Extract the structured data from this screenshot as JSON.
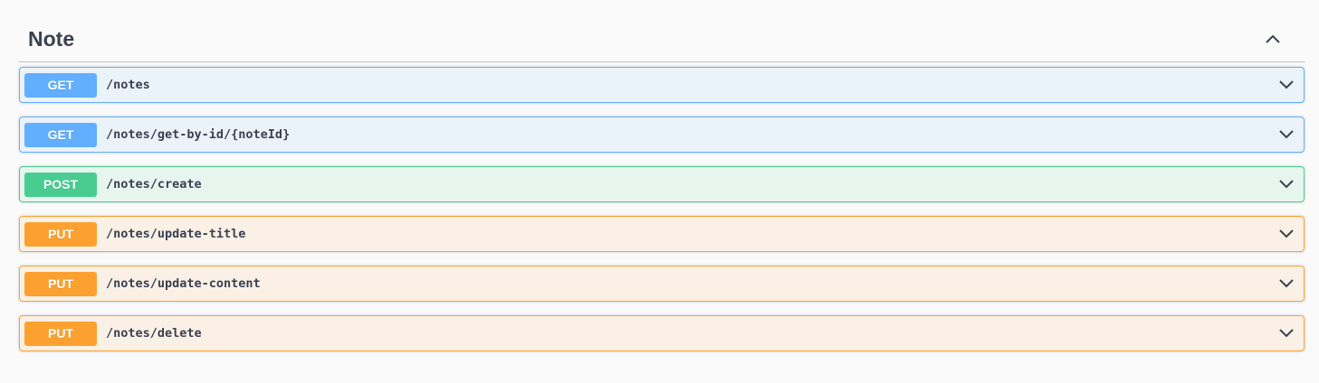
{
  "tag": {
    "title": "Note",
    "toggle_icon": "chevron-up-icon"
  },
  "operations": [
    {
      "method": "GET",
      "path": "/notes",
      "kind": "get"
    },
    {
      "method": "GET",
      "path": "/notes/get-by-id/{noteId}",
      "kind": "get"
    },
    {
      "method": "POST",
      "path": "/notes/create",
      "kind": "post"
    },
    {
      "method": "PUT",
      "path": "/notes/update-title",
      "kind": "put"
    },
    {
      "method": "PUT",
      "path": "/notes/update-content",
      "kind": "put"
    },
    {
      "method": "PUT",
      "path": "/notes/delete",
      "kind": "put"
    }
  ],
  "colors": {
    "get": "#61affe",
    "post": "#49cc90",
    "put": "#fca130",
    "text": "#3b4151"
  }
}
